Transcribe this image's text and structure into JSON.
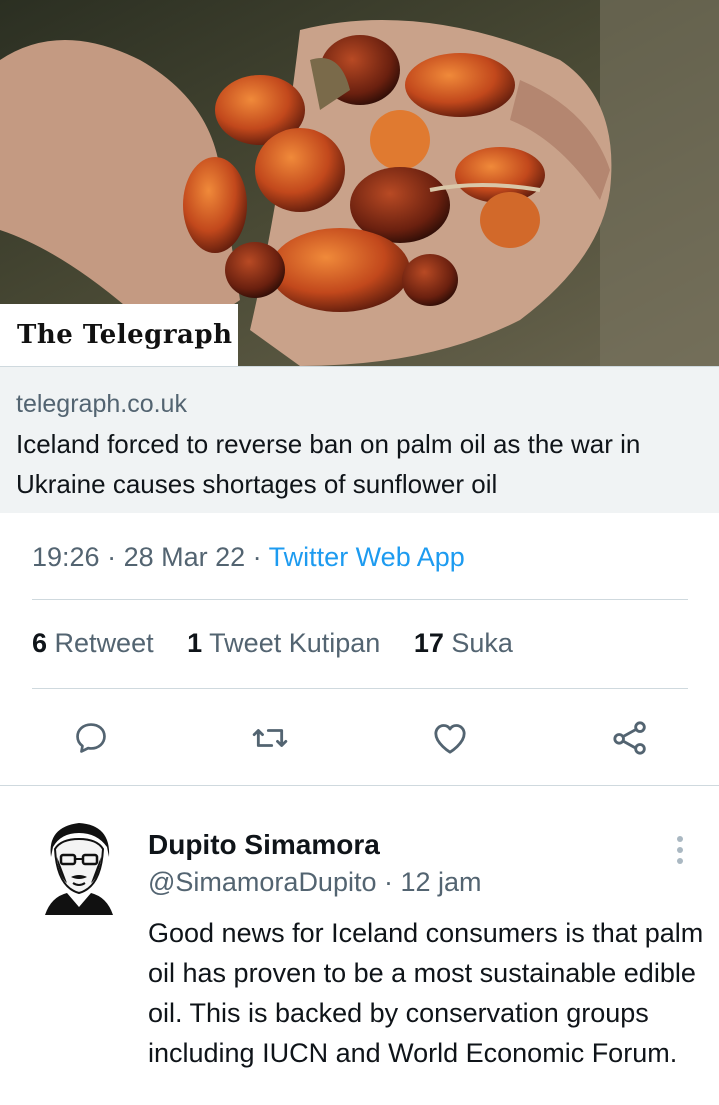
{
  "card": {
    "publisher_logo_text": "The Telegraph",
    "domain": "telegraph.co.uk",
    "title": "Iceland forced to reverse ban on palm oil as the war in Ukraine causes shortages of sunflower oil"
  },
  "tweet": {
    "time": "19:26",
    "separator1": " · ",
    "date": "28 Mar 22",
    "separator2": " · ",
    "source": "Twitter Web App"
  },
  "stats": [
    {
      "count": "6",
      "label": "Retweet"
    },
    {
      "count": "1",
      "label": "Tweet Kutipan"
    },
    {
      "count": "17",
      "label": "Suka"
    }
  ],
  "actions": [
    {
      "icon": "reply-icon"
    },
    {
      "icon": "retweet-icon"
    },
    {
      "icon": "like-heart-icon"
    },
    {
      "icon": "share-icon"
    }
  ],
  "reply": {
    "name": "Dupito Simamora",
    "handle": "@SimamoraDupito",
    "separator": " · ",
    "time": "12 jam",
    "text": "Good news for Iceland consumers is that palm oil has proven to be a most sustainable edible oil. This is backed by conservation groups including IUCN and World Economic Forum."
  },
  "colors": {
    "accent": "#1d9bf0",
    "secondary_text": "#536471",
    "card_background": "#f0f3f4"
  }
}
